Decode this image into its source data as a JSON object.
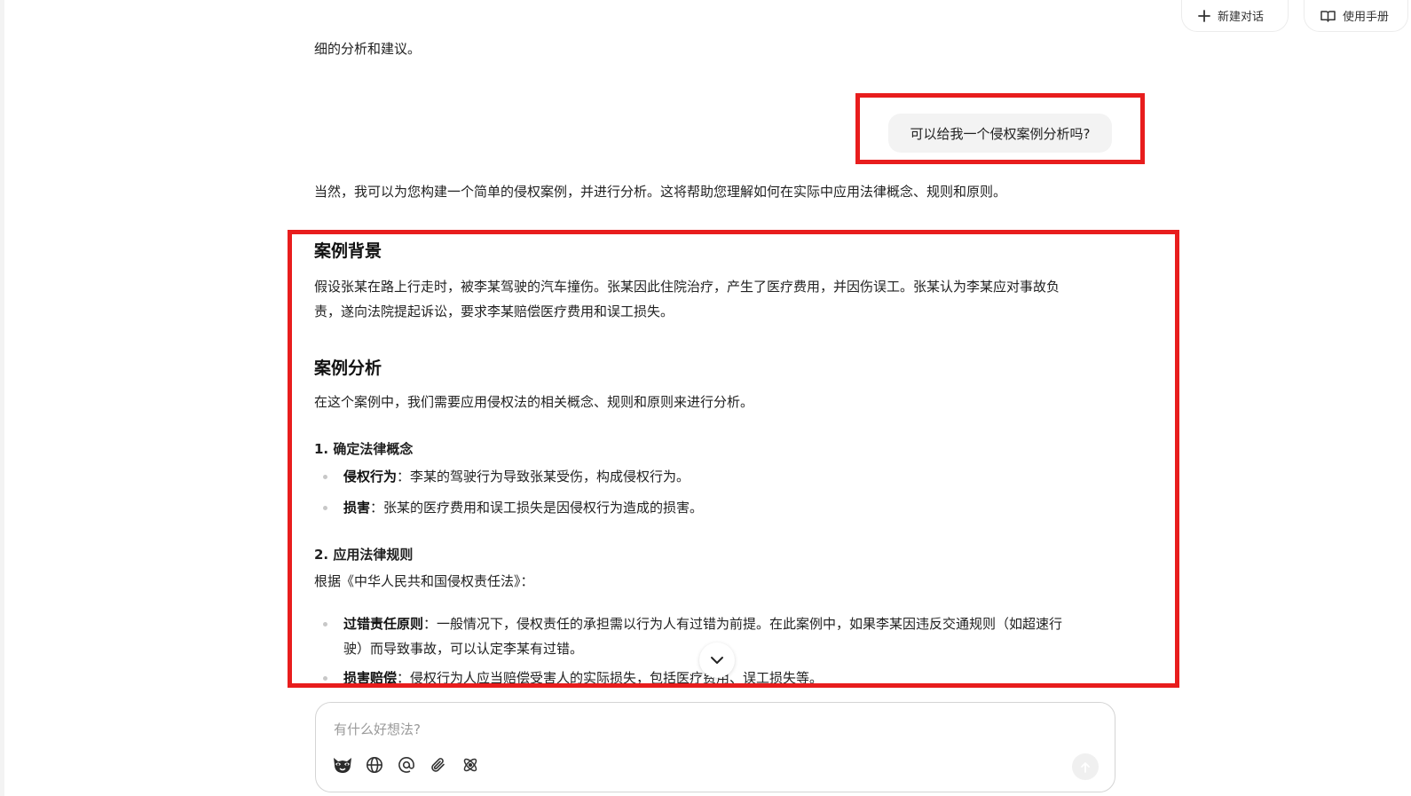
{
  "header": {
    "new_chat_label": "新建对话",
    "manual_label": "使用手册"
  },
  "conversation": {
    "prev_tail": "细的分析和建议。",
    "user_message": "可以给我一个侵权案例分析吗?",
    "intro": "当然，我可以为您构建一个简单的侵权案例，并进行分析。这将帮助您理解如何在实际中应用法律概念、规则和原则。",
    "background": {
      "title": "案例背景",
      "line1": "假设张某在路上行走时，被李某驾驶的汽车撞伤。张某因此住院治疗，产生了医疗费用，并因伤误工。张某认为李某应对事故负",
      "line2": "责，遂向法院提起诉讼，要求李某赔偿医疗费用和误工损失。"
    },
    "analysis": {
      "title": "案例分析",
      "intro": "在这个案例中，我们需要应用侵权法的相关概念、规则和原则来进行分析。",
      "step1": {
        "heading": "1. 确定法律概念",
        "items": [
          {
            "term": "侵权行为",
            "text": "：李某的驾驶行为导致张某受伤，构成侵权行为。"
          },
          {
            "term": "损害",
            "text": "：张某的医疗费用和误工损失是因侵权行为造成的损害。"
          }
        ]
      },
      "step2": {
        "heading": "2. 应用法律规则",
        "intro": "根据《中华人民共和国侵权责任法》：",
        "items": [
          {
            "term": "过错责任原则",
            "line1": "：一般情况下，侵权责任的承担需以行为人有过错为前提。在此案例中，如果李某因违反交通规则（如超速行",
            "line2": "驶）而导致事故，可以认定李某有过错。"
          },
          {
            "term": "损害赔偿",
            "text": "：侵权行为人应当赔偿受害人的实际损失，包括医疗费用、误工损失等。"
          }
        ]
      }
    }
  },
  "composer": {
    "placeholder": "有什么好想法?",
    "tools": [
      "raccoon-icon",
      "globe-icon",
      "at-icon",
      "paperclip-icon",
      "atom-icon"
    ]
  },
  "colors": {
    "highlight_box": "#e81d1d",
    "user_bubble": "#f3f3f3"
  }
}
